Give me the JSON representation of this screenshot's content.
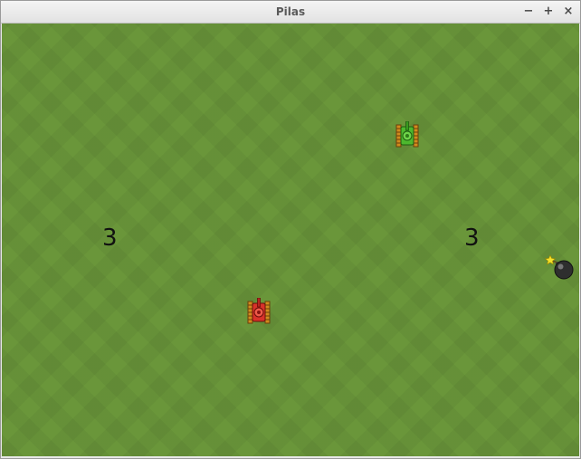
{
  "window": {
    "title": "Pilas",
    "minimize_label": "−",
    "maximize_label": "+",
    "close_label": "×"
  },
  "game": {
    "score_left": "3",
    "score_right": "3",
    "background_color": "#6a963a",
    "actors": [
      {
        "name": "green-tank",
        "color": "#4db82e"
      },
      {
        "name": "red-tank",
        "color": "#d8322a"
      },
      {
        "name": "bomb",
        "color": "#2a2a2a"
      }
    ]
  }
}
